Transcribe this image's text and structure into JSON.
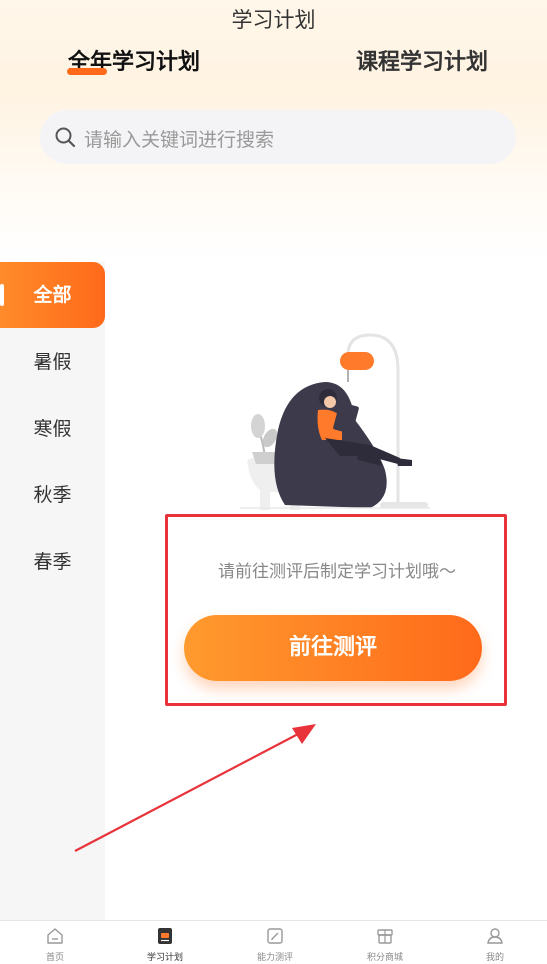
{
  "header": {
    "title": "学习计划",
    "tabs": [
      {
        "label": "全年学习计划",
        "active": true
      },
      {
        "label": "课程学习计划",
        "active": false
      }
    ]
  },
  "search": {
    "placeholder": "请输入关键词进行搜索",
    "icon": "search-icon"
  },
  "sidebar": {
    "items": [
      {
        "label": "全部",
        "active": true
      },
      {
        "label": "暑假",
        "active": false
      },
      {
        "label": "寒假",
        "active": false
      },
      {
        "label": "秋季",
        "active": false
      },
      {
        "label": "春季",
        "active": false
      }
    ]
  },
  "empty_state": {
    "message": "请前往测评后制定学习计划哦～",
    "button_label": "前往测评"
  },
  "tabbar": {
    "items": [
      {
        "label": "首页",
        "icon": "home-icon",
        "active": false
      },
      {
        "label": "学习计划",
        "icon": "plan-icon",
        "active": true
      },
      {
        "label": "能力测评",
        "icon": "assessment-icon",
        "active": false
      },
      {
        "label": "积分商城",
        "icon": "store-icon",
        "active": false
      },
      {
        "label": "我的",
        "icon": "profile-icon",
        "active": false
      }
    ]
  },
  "colors": {
    "accent": "#ff6a1a",
    "annotation": "#e8333b"
  }
}
